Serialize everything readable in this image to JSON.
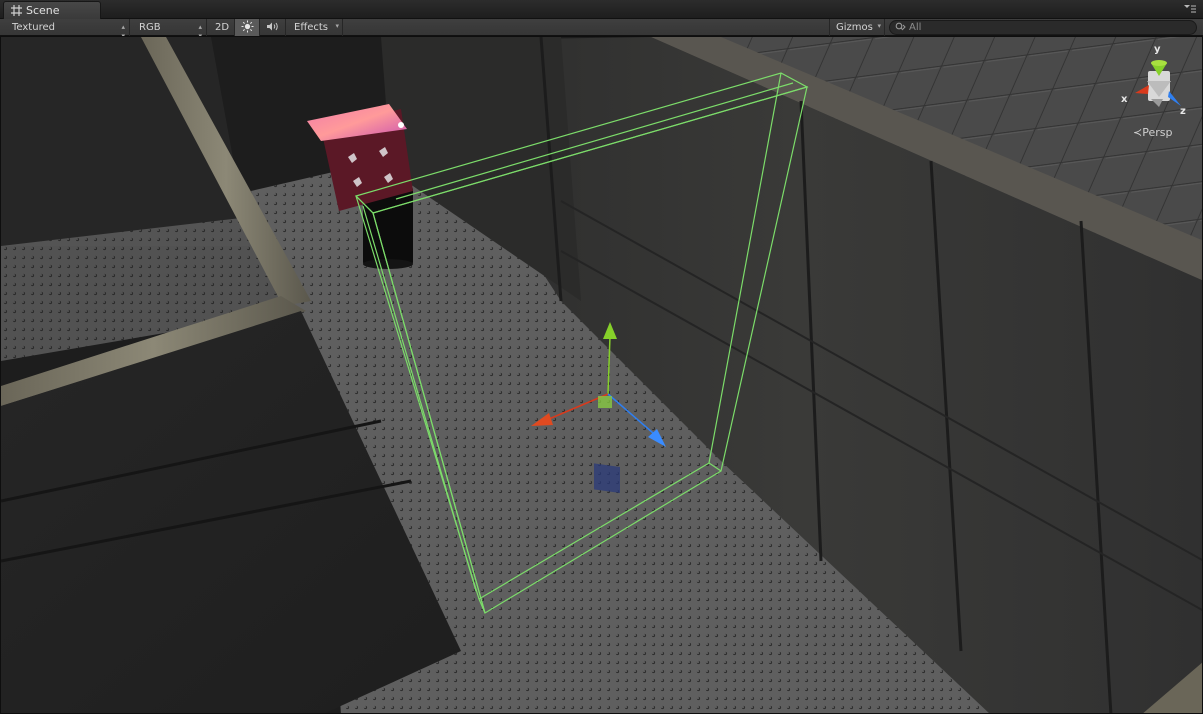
{
  "window": {
    "tab_label": "Scene",
    "tab_icon": "scene-grid-icon",
    "menu_icon": "window-menu-icon"
  },
  "toolbar": {
    "draw_mode": "Textured",
    "render_mode": "RGB",
    "mode_2d": "2D",
    "lighting_icon": "sun-icon",
    "audio_icon": "speaker-icon",
    "effects": "Effects",
    "gizmos": "Gizmos",
    "search_placeholder": "All",
    "search_icon": "search-icon"
  },
  "scene_gizmo": {
    "axis_y": "y",
    "axis_x": "x",
    "axis_z": "z",
    "projection": "Persp"
  },
  "colors": {
    "selection_outline": "#7cdc6a",
    "axis_x": "#d93a1c",
    "axis_y": "#86d02a",
    "axis_z": "#2f7ff0",
    "panel": "#3c3c3c"
  }
}
